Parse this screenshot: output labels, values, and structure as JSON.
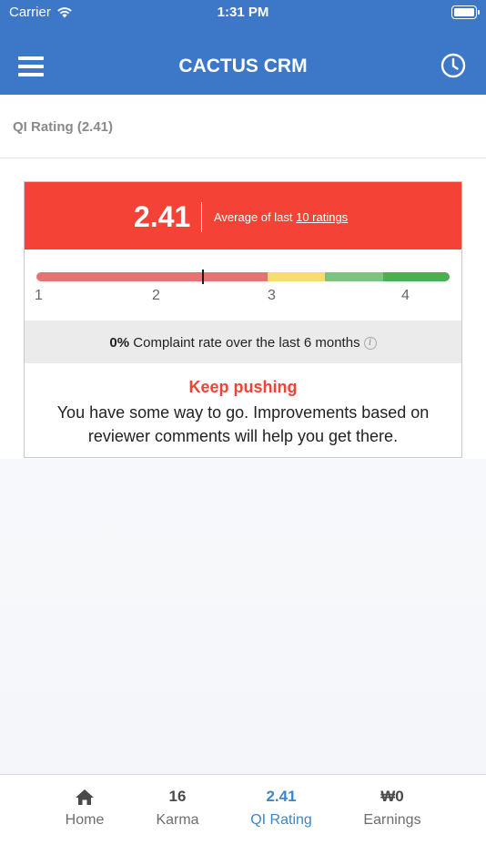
{
  "status_bar": {
    "carrier": "Carrier",
    "time": "1:31 PM"
  },
  "nav": {
    "title": "CACTUS CRM",
    "menu_icon": "hamburger-menu-icon",
    "history_icon": "clock-icon"
  },
  "subheader": {
    "label": "QI Rating (2.41)"
  },
  "card": {
    "score": "2.41",
    "average_prefix": "Average of last ",
    "average_link": "10 ratings",
    "scale_labels": [
      "1",
      "2",
      "3",
      "4"
    ],
    "indicator_value": 2.41,
    "complaint_percent": "0%",
    "complaint_text": " Complaint rate over the last 6 months",
    "headline": "Keep pushing",
    "body": "You have some way to go. Improvements based on reviewer comments will help you get there."
  },
  "colors": {
    "nav_blue": "#3d78c8",
    "header_red": "#f44336",
    "scale_red": "#e57373",
    "scale_yellow": "#f7dc6f",
    "scale_light_green": "#7cc47f",
    "scale_green": "#4caf50",
    "active_tab": "#3d86c6"
  },
  "tabs": [
    {
      "value": "",
      "label": "Home",
      "icon": "home-icon"
    },
    {
      "value": "16",
      "label": "Karma"
    },
    {
      "value": "2.41",
      "label": "QI Rating",
      "active": true
    },
    {
      "value": "₩0",
      "label": "Earnings"
    }
  ]
}
